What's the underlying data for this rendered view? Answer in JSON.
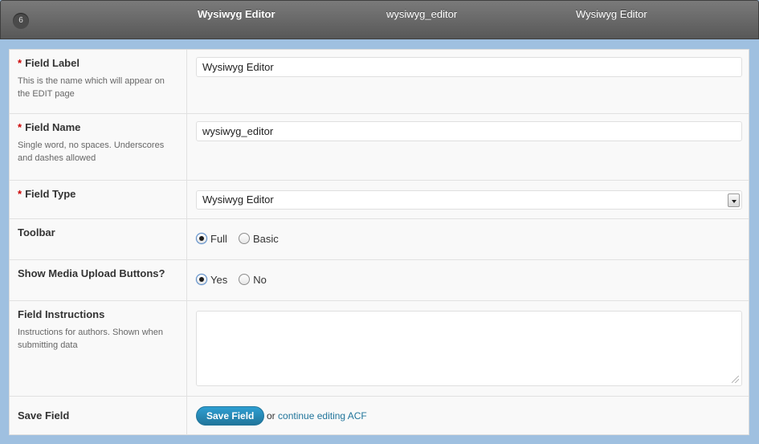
{
  "header": {
    "order_number": "6",
    "field_label": "Wysiwyg Editor",
    "field_name": "wysiwyg_editor",
    "field_type": "Wysiwyg Editor"
  },
  "form": {
    "required_marker": "*",
    "field_label": {
      "title": "Field Label",
      "description": "This is the name which will appear on the EDIT page",
      "value": "Wysiwyg Editor"
    },
    "field_name": {
      "title": "Field Name",
      "description": "Single word, no spaces. Underscores and dashes allowed",
      "value": "wysiwyg_editor"
    },
    "field_type": {
      "title": "Field Type",
      "selected": "Wysiwyg Editor"
    },
    "toolbar": {
      "title": "Toolbar",
      "options": [
        "Full",
        "Basic"
      ],
      "selected": "Full"
    },
    "media_upload": {
      "title": "Show Media Upload Buttons?",
      "options": [
        "Yes",
        "No"
      ],
      "selected": "Yes"
    },
    "instructions": {
      "title": "Field Instructions",
      "description": "Instructions for authors. Shown when submitting data",
      "value": ""
    },
    "save": {
      "title": "Save Field",
      "button_label": "Save Field",
      "or_text": "or",
      "link_text": "continue editing ACF"
    }
  },
  "colors": {
    "accent": "#21759b",
    "required": "#cc0000",
    "header_bg": "#666666",
    "page_bg": "#9fc0e0"
  }
}
